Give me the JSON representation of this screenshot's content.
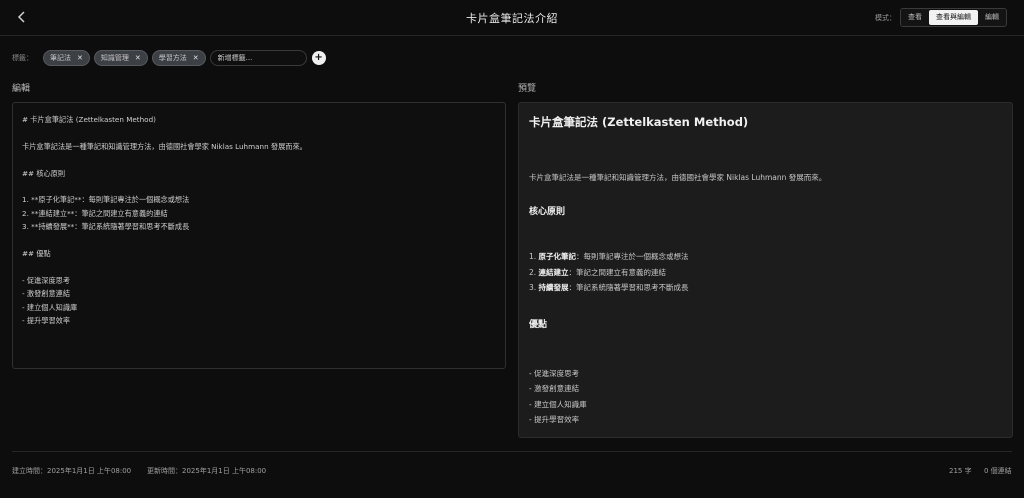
{
  "header": {
    "back_icon": "chevron-left-icon",
    "title": "卡片盒筆記法介紹",
    "mode_label": "模式：",
    "modes": [
      "查看",
      "查看與編輯",
      "編輯"
    ],
    "active_mode": "查看與編輯"
  },
  "tags": {
    "label": "標籤：",
    "items": [
      "筆記法",
      "知識管理",
      "學習方法"
    ],
    "input_placeholder": "新增標籤...",
    "add_icon": "plus-icon"
  },
  "editor": {
    "label": "編輯",
    "content": "# 卡片盒筆記法 (Zettelkasten Method)\n\n卡片盒筆記法是一種筆記和知識管理方法，由德國社會學家 Niklas Luhmann 發展而來。\n\n## 核心原則\n\n1. **原子化筆記**：每則筆記專注於一個概念或想法\n2. **連結建立**：筆記之間建立有意義的連結\n3. **持續發展**：筆記系統隨著學習和思考不斷成長\n\n## 優點\n\n- 促進深度思考\n- 激發創意連結\n- 建立個人知識庫\n- 提升學習效率"
  },
  "preview": {
    "label": "預覽",
    "h1": "卡片盒筆記法 (Zettelkasten Method)",
    "intro": "卡片盒筆記法是一種筆記和知識管理方法，由德國社會學家 Niklas Luhmann 發展而來。",
    "h2_principles": "核心原則",
    "principles": [
      {
        "num": "1.",
        "bold": "原子化筆記",
        "text": "：每則筆記專注於一個概念或想法"
      },
      {
        "num": "2.",
        "bold": "連結建立",
        "text": "：筆記之間建立有意義的連結"
      },
      {
        "num": "3.",
        "bold": "持續發展",
        "text": "：筆記系統隨著學習和思考不斷成長"
      }
    ],
    "h2_benefits": "優點",
    "benefits": [
      "- 促進深度思考",
      "- 激發創意連結",
      "- 建立個人知識庫",
      "- 提升學習效率"
    ]
  },
  "footer": {
    "created": "建立時間：2025年1月1日 上午08:00",
    "updated": "更新時間：2025年1月1日 上午08:00",
    "word_count": "215 字",
    "link_count": "0 個連結"
  }
}
